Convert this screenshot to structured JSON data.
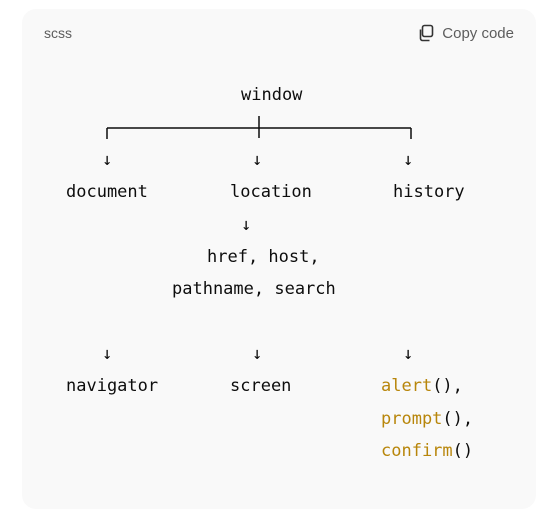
{
  "header": {
    "language": "scss",
    "copy_label": "Copy code"
  },
  "icons": {
    "copy": "copy-icon"
  },
  "colors": {
    "background": "#f9f9f9",
    "text": "#0d0d0d",
    "function_highlight": "#b8860b",
    "muted": "#5d5d5d"
  },
  "diagram": {
    "root": "window",
    "arrow": "↓",
    "row1": [
      "document",
      "location",
      "history"
    ],
    "location_props_line1": "href, host,",
    "location_props_line2": "pathname, search",
    "row2": [
      "navigator",
      "screen"
    ],
    "dialogs": [
      {
        "name": "alert",
        "suffix": "(),"
      },
      {
        "name": "prompt",
        "suffix": "(),"
      },
      {
        "name": "confirm",
        "suffix": "()"
      }
    ]
  }
}
